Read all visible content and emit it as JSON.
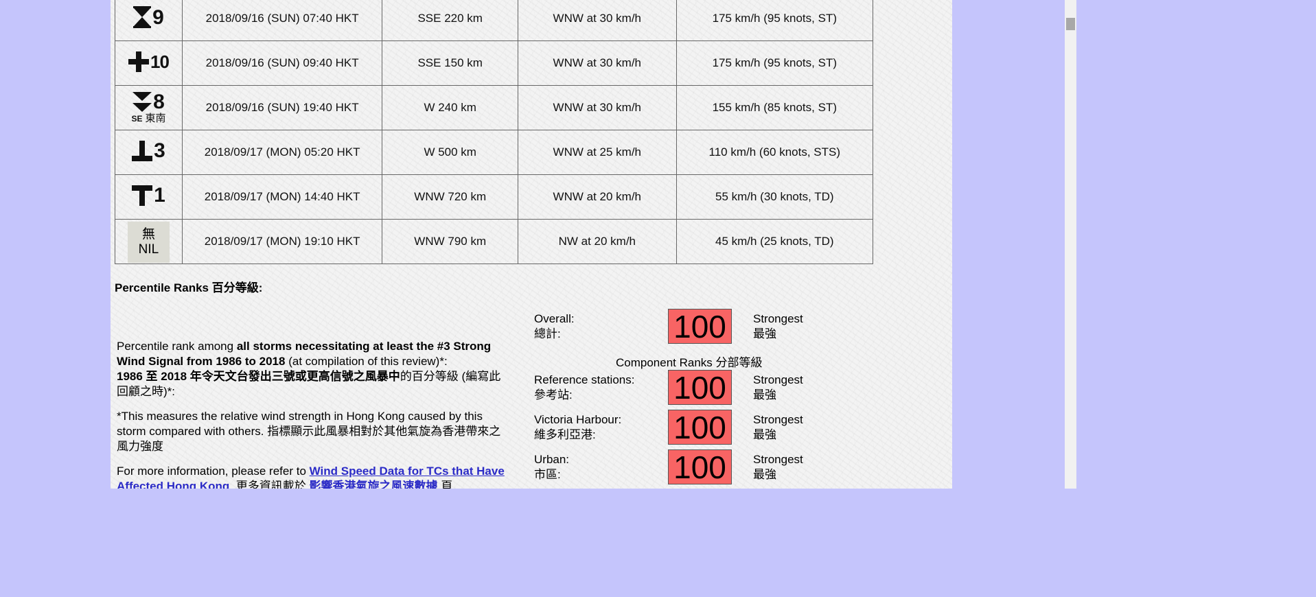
{
  "signal_table": {
    "rows": [
      {
        "signal": "9",
        "signal_icon": "signal-9-hourglass-icon",
        "time": "2018/09/16 (SUN) 07:40 HKT",
        "position": "SSE 220 km",
        "movement": "WNW at 30 km/h",
        "max_wind": "175 km/h (95 knots, ST)"
      },
      {
        "signal": "10",
        "signal_icon": "signal-10-cross-icon",
        "time": "2018/09/16 (SUN) 09:40 HKT",
        "position": "SSE 150 km",
        "movement": "WNW at 30 km/h",
        "max_wind": "175 km/h (95 knots, ST)"
      },
      {
        "signal": "8",
        "signal_icon": "signal-8-se-triangles-icon",
        "signal_sub_en": "SE",
        "signal_sub_zh": "東南",
        "time": "2018/09/16 (SUN) 19:40 HKT",
        "position": "W 240 km",
        "movement": "WNW at 30 km/h",
        "max_wind": "155 km/h (85 knots, ST)"
      },
      {
        "signal": "3",
        "signal_icon": "signal-3-inverted-t-icon",
        "time": "2018/09/17 (MON) 05:20 HKT",
        "position": "W 500 km",
        "movement": "WNW at 25 km/h",
        "max_wind": "110 km/h (60 knots, STS)"
      },
      {
        "signal": "1",
        "signal_icon": "signal-1-t-icon",
        "time": "2018/09/17 (MON) 14:40 HKT",
        "position": "WNW 720 km",
        "movement": "WNW at 20 km/h",
        "max_wind": "55 km/h (30 knots, TD)"
      },
      {
        "signal_zh": "無",
        "signal_en": "NIL",
        "signal_icon": "signal-nil-icon",
        "time": "2018/09/17 (MON) 19:10 HKT",
        "position": "WNW 790 km",
        "movement": "NW at 20 km/h",
        "max_wind": "45 km/h (25 knots, TD)"
      }
    ]
  },
  "percentile": {
    "heading": "Percentile Ranks 百分等級:",
    "intro_en_1": "Percentile rank among ",
    "intro_en_bold": "all storms necessitating at least the #3 Strong Wind Signal from 1986 to 2018",
    "intro_en_2": " (at compilation of this review)*:",
    "intro_zh_bold": "1986 至 2018 年令天文台發出三號或更高信號之風暴中",
    "intro_zh_2": "的百分等級 (編寫此回顧之時)*:",
    "note": "*This measures the relative wind strength in Hong Kong caused by this storm compared with others. 指標顯示此風暴相對於其他氣旋為香港帶來之風力強度",
    "more_info_1": "For more information, please refer to ",
    "more_info_link": "Wind Speed Data for TCs that Have Affected Hong Kong",
    "more_info_2": ". 更多資訊載於 ",
    "more_info_link_zh": "影響香港氣旋之風速數據",
    "more_info_3": " 頁",
    "overall": {
      "label_en": "Overall:",
      "label_zh": "總計:",
      "value": "100",
      "desc_en": "Strongest",
      "desc_zh": "最強"
    },
    "component_heading": "Component Ranks 分部等級",
    "components": [
      {
        "label_en": "Reference stations:",
        "label_zh": "參考站:",
        "value": "100",
        "desc_en": "Strongest",
        "desc_zh": "最強"
      },
      {
        "label_en": "Victoria Harbour:",
        "label_zh": "維多利亞港:",
        "value": "100",
        "desc_en": "Strongest",
        "desc_zh": "最強"
      },
      {
        "label_en": "Urban:",
        "label_zh": "市區:",
        "value": "100",
        "desc_en": "Strongest",
        "desc_zh": "最強"
      }
    ],
    "rank_box_color": "#f86464"
  },
  "colors": {
    "page_background": "#c5c5fc",
    "link": "#2b2bc7"
  }
}
